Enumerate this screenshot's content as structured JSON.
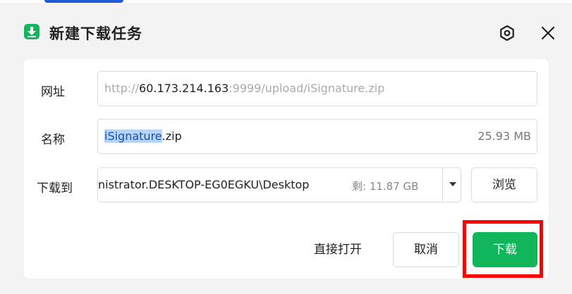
{
  "window": {
    "title": "新建下载任务",
    "app_icon": "download-arrow-icon",
    "accent_color": "#11b65a",
    "highlight_color": "#ff0000"
  },
  "form": {
    "url": {
      "label": "网址",
      "prefix": "http://",
      "host": "60.173.214.163",
      "suffix": ":9999/upload/iSignature.zip"
    },
    "name": {
      "label": "名称",
      "selected_part": "iSignature",
      "rest": ".zip",
      "size": "25.93 MB"
    },
    "save_to": {
      "label": "下载到",
      "path": "nistrator.DESKTOP-EG0EGKU\\Desktop",
      "free_space": "剩: 11.87 GB"
    }
  },
  "buttons": {
    "browse": "浏览",
    "open_directly": "直接打开",
    "cancel": "取消",
    "download": "下载"
  }
}
